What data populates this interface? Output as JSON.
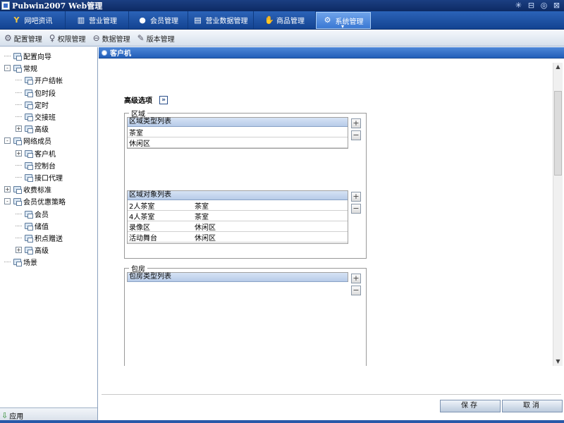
{
  "window": {
    "title": "Pubwin2007 Web管理",
    "controls": [
      "✳",
      "⊟",
      "◎",
      "⊠"
    ]
  },
  "mainnav": {
    "tabs": [
      {
        "label": "网吧资讯",
        "icon": "logo-icon"
      },
      {
        "label": "营业管理",
        "icon": "bar-chart-icon"
      },
      {
        "label": "会员管理",
        "icon": "user-icon"
      },
      {
        "label": "营业数据管理",
        "icon": "document-icon"
      },
      {
        "label": "商品管理",
        "icon": "hand-icon"
      },
      {
        "label": "系统管理",
        "icon": "gear-icon",
        "active": true
      }
    ]
  },
  "subnav": {
    "items": [
      {
        "label": "配置管理",
        "icon": "gear-icon"
      },
      {
        "label": "权限管理",
        "icon": "key-icon"
      },
      {
        "label": "数据管理",
        "icon": "database-icon"
      },
      {
        "label": "版本管理",
        "icon": "pencil-icon"
      }
    ]
  },
  "sidebar": {
    "tree": [
      {
        "label": "配置向导",
        "level": 0,
        "expander": ""
      },
      {
        "label": "常规",
        "level": 0,
        "expander": "-"
      },
      {
        "label": "开户结帐",
        "level": 1,
        "expander": ""
      },
      {
        "label": "包时段",
        "level": 1,
        "expander": ""
      },
      {
        "label": "定时",
        "level": 1,
        "expander": ""
      },
      {
        "label": "交接班",
        "level": 1,
        "expander": ""
      },
      {
        "label": "高级",
        "level": 1,
        "expander": "+"
      },
      {
        "label": "网络成员",
        "level": 0,
        "expander": "-"
      },
      {
        "label": "客户机",
        "level": 1,
        "expander": "+"
      },
      {
        "label": "控制台",
        "level": 1,
        "expander": ""
      },
      {
        "label": "接口代理",
        "level": 1,
        "expander": ""
      },
      {
        "label": "收费标准",
        "level": 0,
        "expander": "+"
      },
      {
        "label": "会员优惠策略",
        "level": 0,
        "expander": "-"
      },
      {
        "label": "会员",
        "level": 1,
        "expander": ""
      },
      {
        "label": "储值",
        "level": 1,
        "expander": ""
      },
      {
        "label": "积点赠送",
        "level": 1,
        "expander": ""
      },
      {
        "label": "高级",
        "level": 1,
        "expander": "+"
      },
      {
        "label": "场景",
        "level": 0,
        "expander": ""
      }
    ],
    "apply_label": "应用"
  },
  "content": {
    "header_title": "客户机",
    "advanced_label": "高级选项",
    "advanced_btn": "»",
    "region": {
      "legend": "区域",
      "type_list": {
        "header": "区域类型列表",
        "rows": [
          "茶室",
          "休闲区"
        ]
      },
      "object_list": {
        "header": "区域对象列表",
        "rows": [
          [
            "2人茶室",
            "茶室"
          ],
          [
            "4人茶室",
            "茶室"
          ],
          [
            "录像区",
            "休闲区"
          ],
          [
            "活动舞台",
            "休闲区"
          ]
        ]
      }
    },
    "room": {
      "legend": "包房",
      "type_list": {
        "header": "包房类型列表"
      }
    },
    "add_symbol": "+",
    "remove_symbol": "−",
    "scroll_up": "▲",
    "scroll_down": "▼",
    "save_label": "保存",
    "cancel_label": "取消"
  }
}
